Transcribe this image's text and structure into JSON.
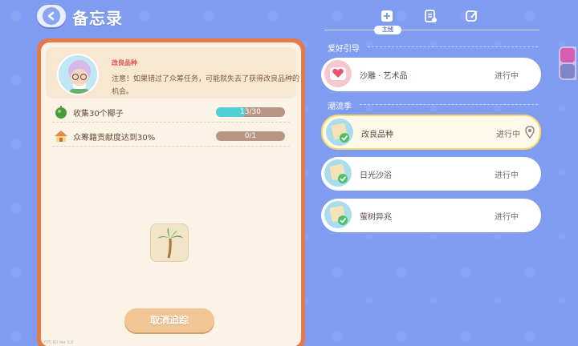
{
  "header": {
    "title": "备忘录",
    "tab_badge": "主线"
  },
  "quest_detail": {
    "name": "改良品种",
    "description": "注意！如果错过了众筹任务，可能就失去了获得改良品种的机会。",
    "tasks": [
      {
        "label": "收集30个椰子",
        "progress_text": "13/30",
        "progress": 0.43,
        "icon": "coconut-icon"
      },
      {
        "label": "众筹籍贡献度达到30%",
        "progress_text": "0/1",
        "progress": 0.0,
        "icon": "house-icon"
      }
    ],
    "reward_icon": "palm-tree-icon",
    "cancel_label": "取消追踪",
    "debug_text": "FPS 60  Ver 1.0"
  },
  "quest_list": {
    "sections": [
      {
        "title": "爱好引导",
        "items": [
          {
            "title": "沙雕 · 艺术品",
            "status": "进行中",
            "icon": "heart-icon",
            "selected": false
          }
        ]
      },
      {
        "title": "潮流季",
        "items": [
          {
            "title": "改良品种",
            "status": "进行中",
            "icon": "map-check-icon",
            "selected": true
          },
          {
            "title": "日光沙浴",
            "status": "进行中",
            "icon": "map-check-icon",
            "selected": false
          },
          {
            "title": "萤树异兆",
            "status": "进行中",
            "icon": "map-check-icon",
            "selected": false
          }
        ]
      }
    ]
  },
  "colors": {
    "background": "#7f9cf0",
    "panel_border": "#e47a4a",
    "panel_bg": "#fbf3e6",
    "selected_border": "#f6d86c",
    "progress_fill": "#4fd0d6",
    "cancel_button": "#f2c694"
  }
}
